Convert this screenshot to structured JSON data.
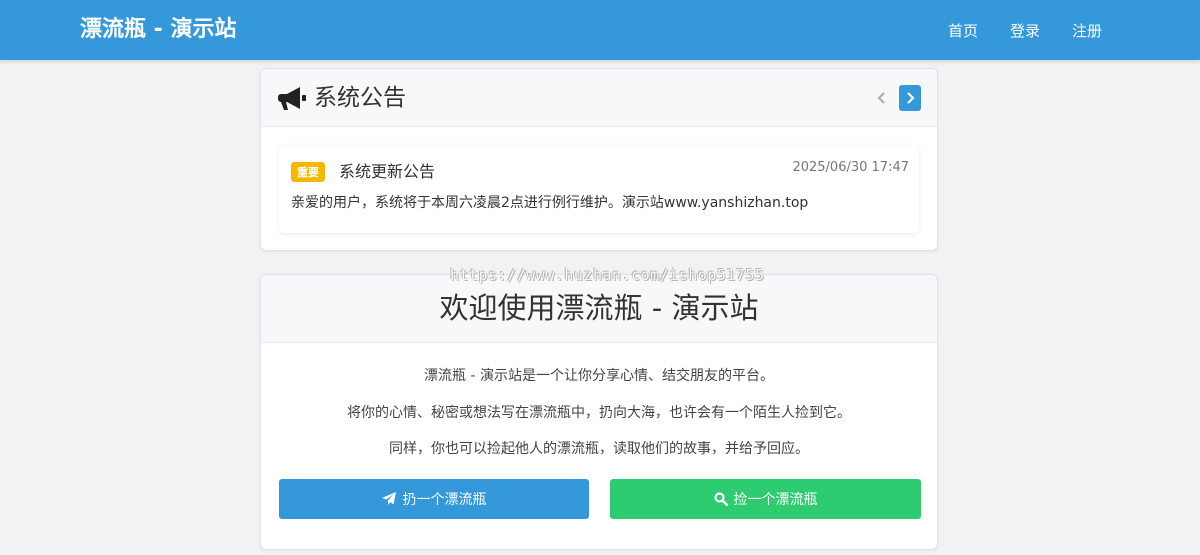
{
  "navbar": {
    "brand": "漂流瓶 - 演示站",
    "links": [
      "首页",
      "登录",
      "注册"
    ]
  },
  "announcement": {
    "title": "系统公告",
    "icon": "megaphone-icon",
    "item": {
      "badge": "重要",
      "title": "系统更新公告",
      "time": "2025/06/30 17:47",
      "body": "亲爱的用户，系统将于本周六凌晨2点进行例行维护。演示站www.yanshizhan.top"
    }
  },
  "watermark": "https://www.huzhan.com/ishop51755",
  "welcome": {
    "title": "欢迎使用漂流瓶 - 演示站",
    "paragraphs": [
      "漂流瓶 - 演示站是一个让你分享心情、结交朋友的平台。",
      "将你的心情、秘密或想法写在漂流瓶中，扔向大海，也许会有一个陌生人捡到它。",
      "同样，你也可以捡起他人的漂流瓶，读取他们的故事，并给予回应。"
    ],
    "throw_label": "扔一个漂流瓶",
    "pick_label": "捡一个漂流瓶"
  },
  "colors": {
    "primary": "#3498db",
    "success": "#2ecc71",
    "badge": "#f5b700"
  }
}
